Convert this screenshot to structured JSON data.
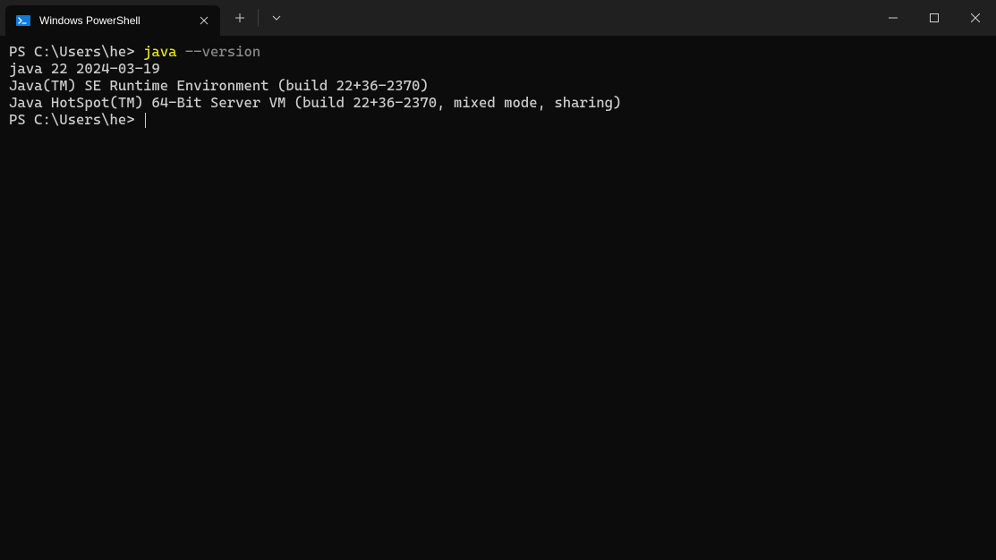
{
  "titlebar": {
    "tab": {
      "title": "Windows PowerShell"
    }
  },
  "terminal": {
    "lines": [
      {
        "prompt": "PS C:\\Users\\he>",
        "cmd_exec": "java",
        "cmd_arg": "--version"
      },
      {
        "text": "java 22 2024-03-19"
      },
      {
        "text": "Java(TM) SE Runtime Environment (build 22+36-2370)"
      },
      {
        "text": "Java HotSpot(TM) 64-Bit Server VM (build 22+36-2370, mixed mode, sharing)"
      },
      {
        "prompt": "PS C:\\Users\\he>",
        "cursor": true
      }
    ]
  }
}
